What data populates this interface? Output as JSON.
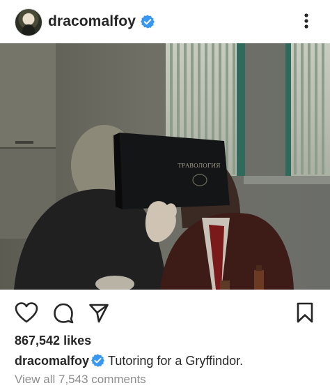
{
  "post": {
    "username": "dracomalfoy",
    "avatar_icon": "profile-avatar",
    "verified_icon": "verified-badge-icon",
    "more_icon": "more-options-icon",
    "photo": {
      "description_icon": "post-photo",
      "book_title": "ТРАВОЛОГИЯ"
    },
    "actions": {
      "like_icon": "heart-icon",
      "comment_icon": "comment-icon",
      "share_icon": "send-icon",
      "save_icon": "bookmark-icon"
    },
    "likes_text": "867,542 likes",
    "caption": {
      "username": "dracomalfoy",
      "text": "Tutoring for a Gryffindor."
    },
    "comments_link": "View all 7,543 comments"
  },
  "colors": {
    "text": "#262626",
    "muted": "#8e8e8e",
    "verified_blue": "#3897f0"
  }
}
